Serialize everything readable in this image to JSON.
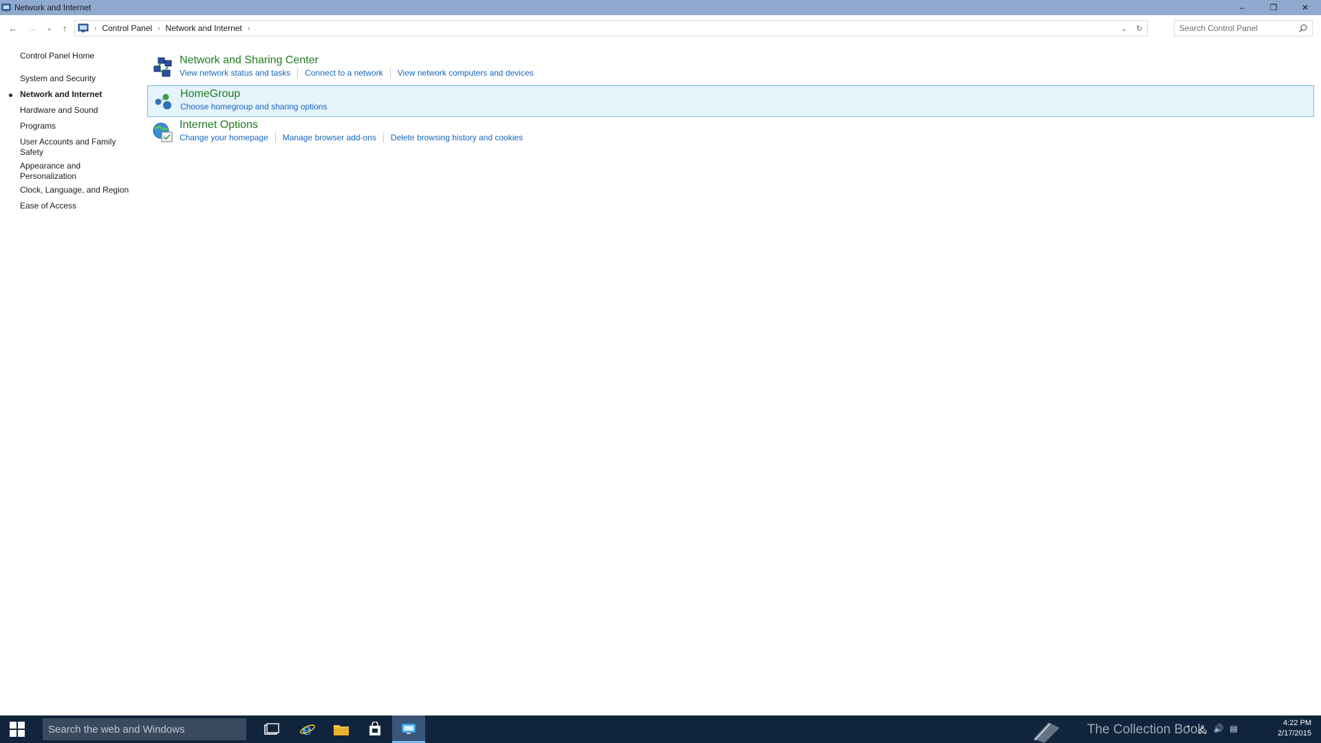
{
  "window": {
    "title": "Network and Internet",
    "controls": {
      "minimize": "–",
      "restore": "❐",
      "close": "✕"
    }
  },
  "navigation": {
    "back_icon": "←",
    "forward_icon": "→",
    "recent_icon": "⌄",
    "up_icon": "↑",
    "breadcrumb": [
      "Control Panel",
      "Network and Internet"
    ],
    "separator": "›",
    "dropdown_icon": "⌄",
    "refresh_icon": "↻",
    "search_placeholder": "Search Control Panel"
  },
  "sidebar": {
    "home": "Control Panel Home",
    "items": [
      {
        "label": "System and Security"
      },
      {
        "label": "Network and Internet",
        "current": true
      },
      {
        "label": "Hardware and Sound"
      },
      {
        "label": "Programs"
      },
      {
        "label": "User Accounts and Family Safety"
      },
      {
        "label": "Appearance and Personalization"
      },
      {
        "label": "Clock, Language, and Region"
      },
      {
        "label": "Ease of Access"
      }
    ]
  },
  "categories": [
    {
      "title": "Network and Sharing Center",
      "icon": "network-sharing-icon",
      "links": [
        "View network status and tasks",
        "Connect to a network",
        "View network computers and devices"
      ]
    },
    {
      "title": "HomeGroup",
      "icon": "homegroup-icon",
      "selected": true,
      "links": [
        "Choose homegroup and sharing options"
      ]
    },
    {
      "title": "Internet Options",
      "icon": "internet-options-icon",
      "links": [
        "Change your homepage",
        "Manage browser add-ons",
        "Delete browsing history and cookies"
      ]
    }
  ],
  "taskbar": {
    "search_placeholder": "Search the web and Windows",
    "apps": [
      "task-view",
      "internet-explorer",
      "file-explorer",
      "store",
      "control-panel"
    ],
    "watermark": "The Collection Book",
    "time": "4:22 PM",
    "date": "2/17/2015"
  },
  "colors": {
    "titlebar": "#8fa9cf",
    "category_title": "#1e7b1e",
    "link": "#1565c0",
    "selection_bg": "#e5f3fb",
    "selection_border": "#70c0e7",
    "taskbar": "#10243d"
  }
}
